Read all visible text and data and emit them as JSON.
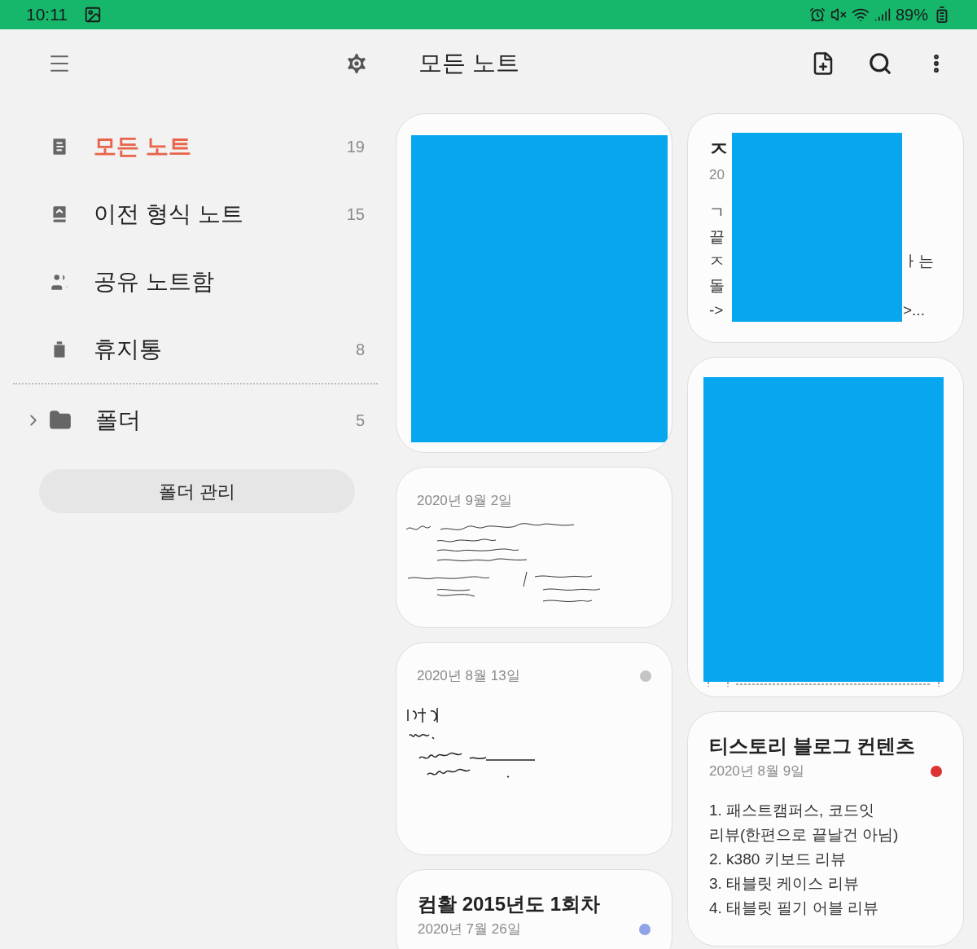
{
  "status_bar": {
    "time": "10:11",
    "battery": "89%"
  },
  "sidebar": {
    "items": [
      {
        "kind": "all",
        "label": "모든 노트",
        "count": "19",
        "selected": true
      },
      {
        "kind": "legacy",
        "label": "이전 형식 노트",
        "count": "15",
        "selected": false
      },
      {
        "kind": "shared",
        "label": "공유 노트함",
        "selected": false
      },
      {
        "kind": "trash",
        "label": "휴지통",
        "count": "8",
        "selected": false
      }
    ],
    "folder": {
      "label": "폴더",
      "count": "5",
      "expanded": false
    },
    "manage_button": "폴더 관리"
  },
  "header": {
    "title": "모든 노트"
  },
  "columns": [
    [
      {
        "kind": "image"
      },
      {
        "kind": "handwriting",
        "date": "2020년 9월 2일"
      },
      {
        "kind": "handwriting",
        "date": "2020년 8월 13일",
        "color": "#c4c4c4"
      },
      {
        "kind": "text",
        "title": "컴활 2015년도 1회차",
        "date": "2020년 7월 26일",
        "color": "#8fa3e6"
      }
    ],
    [
      {
        "kind": "covered_text",
        "title": "ㅈ",
        "date": "20",
        "lines": [
          {
            "left": "ㄱ"
          },
          {
            "left": "끝"
          },
          {
            "left": "ㅈ",
            "right": "ㅏ는"
          },
          {
            "left": "돌"
          },
          {
            "left": "->",
            "right": ">..."
          }
        ]
      },
      {
        "kind": "scan"
      },
      {
        "kind": "text",
        "title": "티스토리 블로그 컨텐츠",
        "date": "2020년 8월 9일",
        "color": "#dd3333",
        "lines": [
          "1. 패스트캠퍼스, 코드잇",
          "리뷰(한편으로 끝날건 아님)",
          "2. k380 키보드 리뷰",
          "3. 태블릿 케이스 리뷰",
          "4. 태블릿 필기 어블 리뷰"
        ]
      }
    ]
  ]
}
